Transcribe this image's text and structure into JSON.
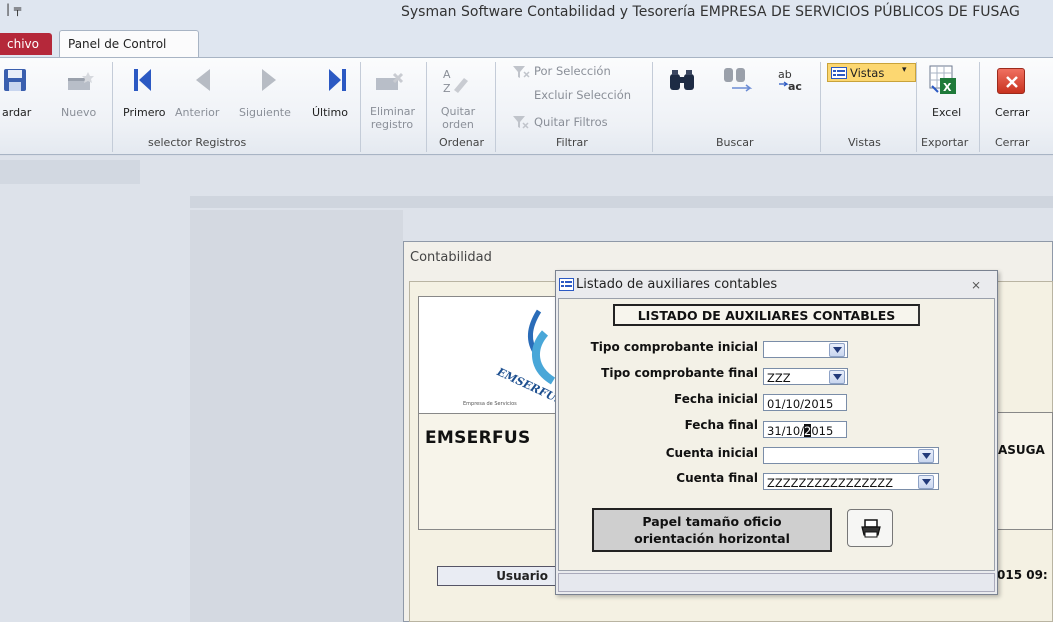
{
  "window": {
    "title": "Sysman Software Contabilidad y Tesorería EMPRESA DE SERVICIOS PÚBLICOS DE FUSAG",
    "qat_mark": "| ╤"
  },
  "tabs": {
    "archivo": "chivo",
    "panel": "Panel de Control"
  },
  "ribbon": {
    "buttons": {
      "guardar": "ardar",
      "nuevo": "Nuevo",
      "primero": "Primero",
      "anterior": "Anterior",
      "siguiente": "Siguiente",
      "ultimo": "Último",
      "eliminar_1": "Eliminar",
      "eliminar_2": "registro",
      "quitar_orden_1": "Quitar",
      "quitar_orden_2": "orden",
      "por_seleccion": "Por Selección",
      "excluir_seleccion": "Excluir Selección",
      "quitar_filtros": "Quitar Filtros",
      "vistas": "Vistas",
      "excel": "Excel",
      "cerrar": "Cerrar"
    },
    "groups": {
      "selector": "selector Registros",
      "ordenar": "Ordenar",
      "filtrar": "Filtrar",
      "buscar": "Buscar",
      "vistas": "Vistas",
      "exportar": "Exportar",
      "cerrar": "Cerrar"
    }
  },
  "background_window": {
    "title": "Contabilidad",
    "company": "EMSERFUS",
    "right_fragment": "ASUGA",
    "usuario_label": "Usuario",
    "time_fragment": "015 09:"
  },
  "dialog": {
    "title": "Listado de auxiliares contables",
    "heading": "LISTADO DE AUXILIARES CONTABLES",
    "fields": {
      "tipo_inicial": {
        "label": "Tipo comprobante inicial",
        "value": ""
      },
      "tipo_final": {
        "label": "Tipo comprobante final",
        "value": "ZZZ"
      },
      "fecha_inicial": {
        "label": "Fecha inicial",
        "value": "01/10/2015"
      },
      "fecha_final": {
        "label": "Fecha final",
        "value_pre": "31/10/",
        "value_sel": "2",
        "value_post": "015"
      },
      "cuenta_inicial": {
        "label": "Cuenta inicial",
        "value": ""
      },
      "cuenta_final": {
        "label": "Cuenta final",
        "value": "ZZZZZZZZZZZZZZZZ"
      }
    },
    "paper_line1": "Papel tamaño oficio",
    "paper_line2": "orientación horizontal"
  },
  "colors": {
    "archivo_tab": "#b5283a",
    "nav_arrows": "#2b59c3",
    "vistas_highlight": "#fcd771"
  }
}
